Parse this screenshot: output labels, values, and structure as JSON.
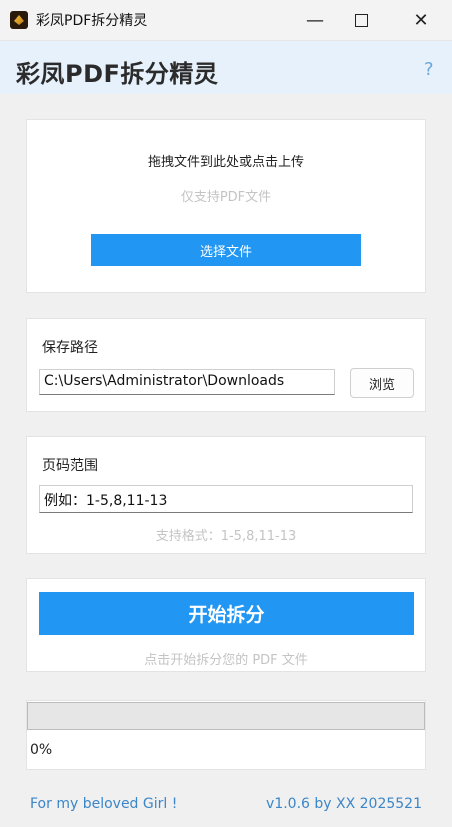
{
  "window": {
    "title": "彩凤PDF拆分精灵",
    "min_glyph": "—",
    "close_glyph": "✕"
  },
  "header": {
    "title": "彩凤PDF拆分精灵",
    "help": "?"
  },
  "dropzone": {
    "main_text": "拖拽文件到此处或点击上传",
    "sub_text": "仅支持PDF文件",
    "button_label": "选择文件"
  },
  "save": {
    "label": "保存路径",
    "path_value": "C:\\Users\\Administrator\\Downloads",
    "browse_label": "浏览"
  },
  "range": {
    "label": "页码范围",
    "placeholder": "例如：1-5,8,11-13",
    "hint": "支持格式：1-5,8,11-13"
  },
  "start": {
    "button_label": "开始拆分",
    "hint": "点击开始拆分您的 PDF 文件"
  },
  "progress": {
    "value": 0,
    "text": "0%"
  },
  "footer": {
    "left": "For my beloved Girl !",
    "right": "v1.0.6 by XX 2025521"
  },
  "colors": {
    "accent": "#2196f3",
    "header_bg": "#e6f1fb",
    "hint": "#c4c4c4",
    "footer": "#3b86c8"
  }
}
